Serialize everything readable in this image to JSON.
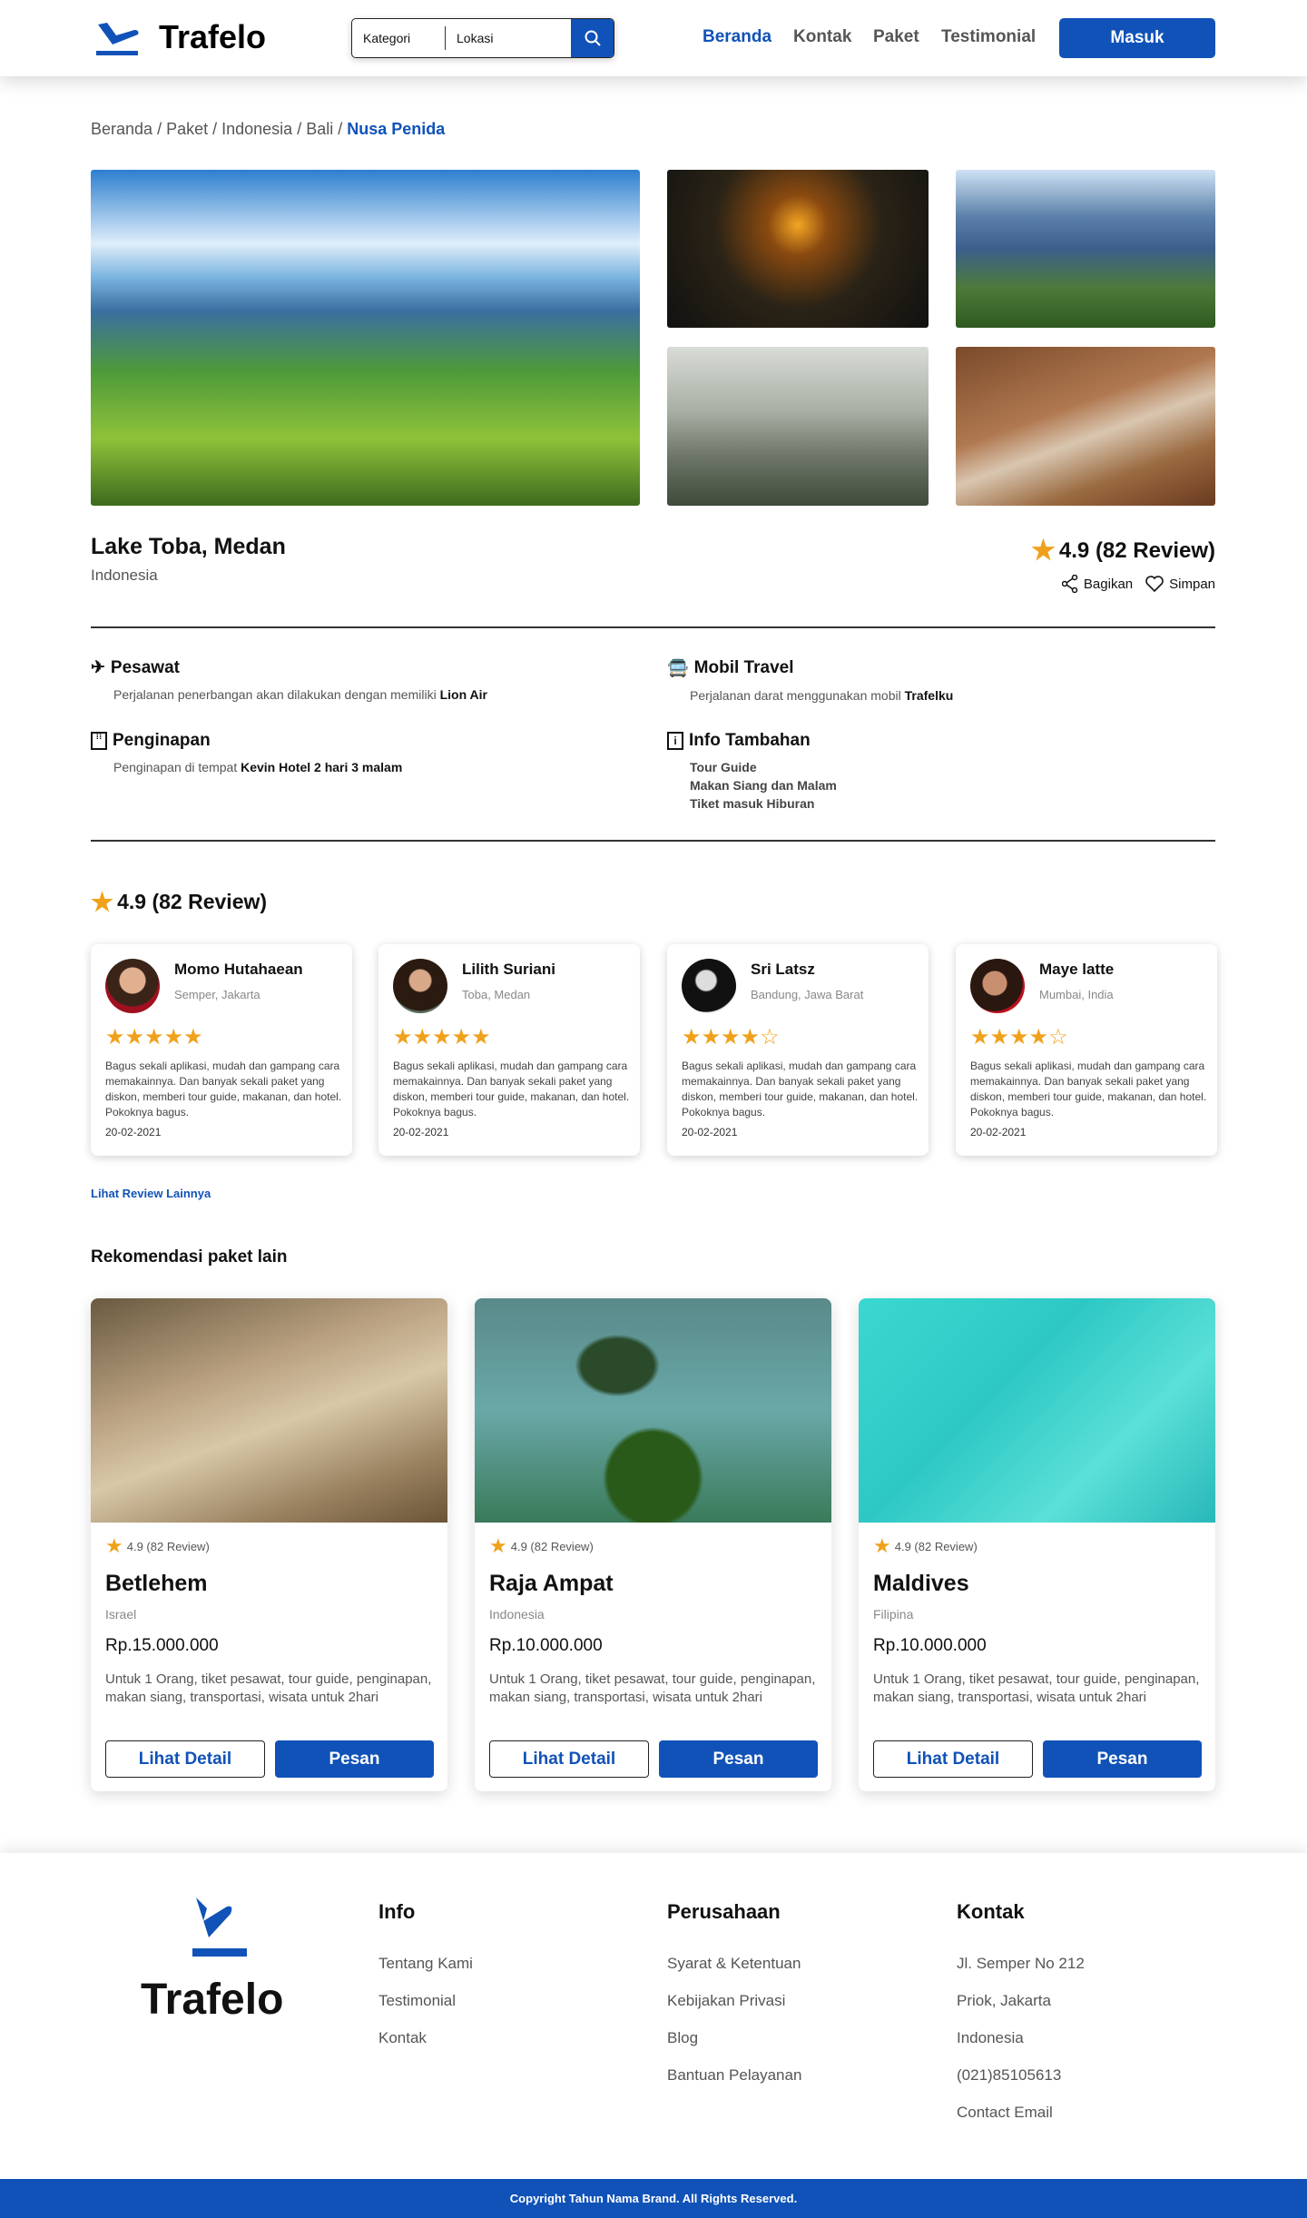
{
  "brand": {
    "name": "Trafelo",
    "accent": "#1052b8",
    "star": "#f0a11c"
  },
  "search": {
    "category": "Kategori",
    "location": "Lokasi"
  },
  "nav": {
    "items": [
      "Beranda",
      "Kontak",
      "Paket",
      "Testimonial"
    ],
    "login": "Masuk"
  },
  "breadcrumb": {
    "items": [
      "Beranda",
      "Paket",
      "Indonesia",
      "Bali"
    ],
    "current": "Nusa Penida",
    "sep": " / "
  },
  "destination": {
    "title": "Lake Toba, Medan",
    "country": "Indonesia",
    "rating": "4.9 (82 Review)",
    "share": "Bagikan",
    "save": "Simpan"
  },
  "features": {
    "flight": {
      "title": "Pesawat",
      "text": "Perjalanan penerbangan akan dilakukan dengan memiliki ",
      "bold": "Lion Air"
    },
    "car": {
      "title": "Mobil Travel",
      "text": "Perjalanan darat menggunakan mobil ",
      "bold": "Trafelku"
    },
    "hotel": {
      "title": "Penginapan",
      "text": "Penginapan di tempat ",
      "bold": "Kevin Hotel 2 hari 3 malam"
    },
    "extra": {
      "title": "Info Tambahan",
      "items": [
        "Tour Guide",
        "Makan Siang dan Malam",
        "Tiket masuk Hiburan"
      ]
    }
  },
  "reviews": {
    "heading": "4.9 (82 Review)",
    "more": "Lihat Review Lainnya",
    "items": [
      {
        "name": "Momo Hutahaean",
        "location": "Semper, Jakarta",
        "stars": "★★★★★",
        "rating": 5,
        "text": "Bagus sekali aplikasi, mudah dan gampang cara memakainnya. Dan banyak sekali paket yang diskon, memberi tour guide, makanan, dan hotel. Pokoknya bagus.",
        "date": "20-02-2021"
      },
      {
        "name": "Lilith Suriani",
        "location": "Toba, Medan",
        "stars": "★★★★★",
        "rating": 5,
        "text": "Bagus sekali aplikasi, mudah dan gampang cara memakainnya. Dan banyak sekali paket yang diskon, memberi tour guide, makanan, dan hotel. Pokoknya bagus.",
        "date": "20-02-2021"
      },
      {
        "name": "Sri Latsz",
        "location": "Bandung, Jawa Barat",
        "stars": "★★★★☆",
        "rating": 4,
        "text": "Bagus sekali aplikasi, mudah dan gampang cara memakainnya. Dan banyak sekali paket yang diskon, memberi tour guide, makanan, dan hotel. Pokoknya bagus.",
        "date": "20-02-2021"
      },
      {
        "name": "Maye latte",
        "location": "Mumbai, India",
        "stars": "★★★★☆",
        "rating": 4,
        "text": "Bagus sekali aplikasi, mudah dan gampang cara memakainnya. Dan banyak sekali paket yang diskon, memberi tour guide, makanan, dan hotel. Pokoknya bagus.",
        "date": "20-02-2021"
      }
    ]
  },
  "recommendations": {
    "heading": "Rekomendasi paket lain",
    "detail_label": "Lihat Detail",
    "book_label": "Pesan",
    "items": [
      {
        "rating": "4.9 (82 Review)",
        "name": "Betlehem",
        "country": "Israel",
        "price": "Rp.15.000.000",
        "desc": "Untuk 1 Orang, tiket pesawat, tour guide, penginapan, makan siang, transportasi, wisata untuk 2hari"
      },
      {
        "rating": "4.9 (82 Review)",
        "name": "Raja Ampat",
        "country": "Indonesia",
        "price": "Rp.10.000.000",
        "desc": "Untuk 1 Orang, tiket pesawat, tour guide, penginapan, makan siang, transportasi, wisata untuk 2hari"
      },
      {
        "rating": "4.9 (82 Review)",
        "name": "Maldives",
        "country": "Filipina",
        "price": "Rp.10.000.000",
        "desc": "Untuk 1 Orang, tiket pesawat, tour guide, penginapan, makan siang, transportasi, wisata untuk 2hari"
      }
    ]
  },
  "footer": {
    "info": {
      "title": "Info",
      "items": [
        "Tentang Kami",
        "Testimonial",
        "Kontak"
      ]
    },
    "company": {
      "title": "Perusahaan",
      "items": [
        "Syarat & Ketentuan",
        "Kebijakan Privasi",
        "Blog",
        "Bantuan Pelayanan"
      ]
    },
    "contact": {
      "title": "Kontak",
      "items": [
        "Jl. Semper No 212",
        "Priok, Jakarta",
        "Indonesia",
        "(021)85105613",
        "Contact Email"
      ]
    },
    "copyright": "Copyright Tahun Nama Brand. All Rights Reserved."
  }
}
